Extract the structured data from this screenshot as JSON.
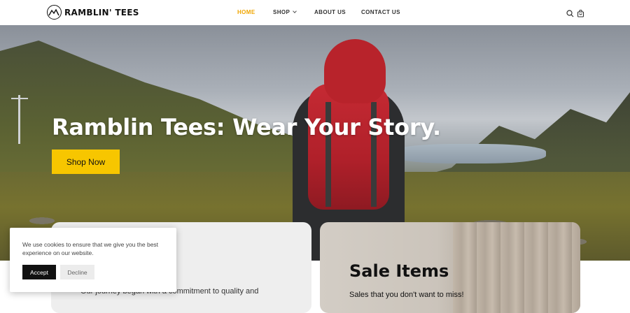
{
  "brand": {
    "name": "RAMBLIN' TEES"
  },
  "nav": {
    "items": [
      {
        "label": "HOME",
        "active": true
      },
      {
        "label": "SHOP",
        "has_dropdown": true
      },
      {
        "label": "ABOUT US"
      },
      {
        "label": "CONTACT US"
      }
    ],
    "icons": [
      "search-icon",
      "cart-icon"
    ]
  },
  "hero": {
    "title": "Ramblin Tees: Wear Your Story.",
    "button_label": "Shop Now"
  },
  "cards": {
    "left": {
      "text": "Our journey began with a commitment to quality and"
    },
    "right": {
      "title": "Sale Items",
      "subtitle": "Sales that you don't want to miss!"
    }
  },
  "cookie": {
    "message": "We use cookies to ensure that we give you the best experience on our website.",
    "accept_label": "Accept",
    "decline_label": "Decline"
  },
  "colors": {
    "accent": "#f0a500",
    "button": "#f7c600",
    "dark": "#111111"
  }
}
